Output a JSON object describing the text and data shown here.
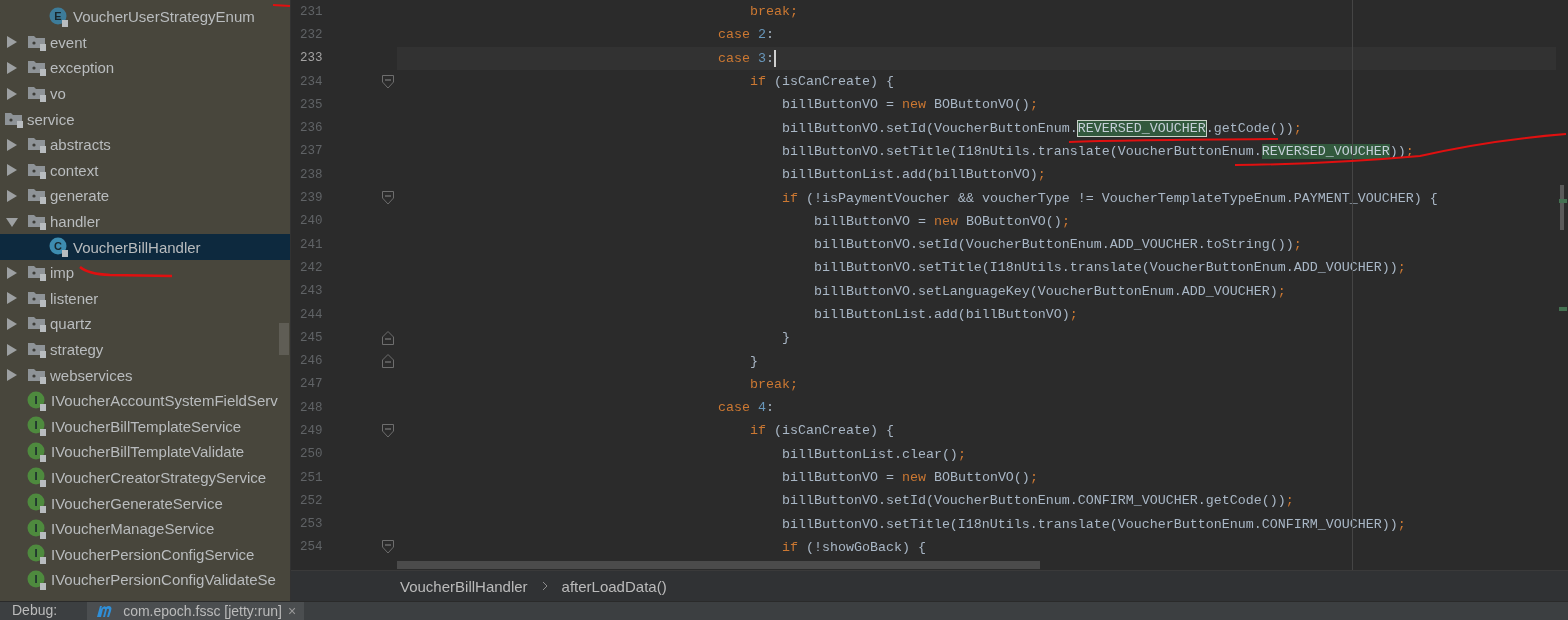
{
  "project_tree": [
    {
      "children": [
        {
          "children": [
            {
              "kind": "enum",
              "icon_letter": "E",
              "label": "VoucherUserStrategyEnum",
              "selected": false
            }
          ]
        },
        {
          "kind": "folder",
          "label": "event",
          "expanded": false,
          "selected": false
        },
        {
          "kind": "folder",
          "label": "exception",
          "expanded": false,
          "selected": false
        },
        {
          "kind": "folder",
          "label": "vo",
          "expanded": false,
          "selected": false
        }
      ]
    },
    {
      "kind": "package",
      "label": "service",
      "selected": false,
      "children": [
        {
          "kind": "folder",
          "label": "abstracts",
          "expanded": false,
          "selected": false
        },
        {
          "kind": "folder",
          "label": "context",
          "expanded": false,
          "selected": false
        },
        {
          "kind": "folder",
          "label": "generate",
          "expanded": false,
          "selected": false
        },
        {
          "kind": "folder",
          "label": "handler",
          "expanded": true,
          "selected": false,
          "children": [
            {
              "kind": "class",
              "icon_letter": "C",
              "label": "VoucherBillHandler",
              "selected": true
            }
          ]
        },
        {
          "kind": "folder",
          "label": "imp",
          "expanded": false,
          "selected": false
        },
        {
          "kind": "folder",
          "label": "listener",
          "expanded": false,
          "selected": false
        },
        {
          "kind": "folder",
          "label": "quartz",
          "expanded": false,
          "selected": false
        },
        {
          "kind": "folder",
          "label": "strategy",
          "expanded": false,
          "selected": false
        },
        {
          "kind": "folder",
          "label": "webservices",
          "expanded": false,
          "selected": false
        },
        {
          "kind": "interface",
          "icon_letter": "I",
          "label": "IVoucherAccountSystemFieldServ",
          "selected": false
        },
        {
          "kind": "interface",
          "icon_letter": "I",
          "label": "IVoucherBillTemplateService",
          "selected": false
        },
        {
          "kind": "interface",
          "icon_letter": "I",
          "label": "IVoucherBillTemplateValidate",
          "selected": false
        },
        {
          "kind": "interface",
          "icon_letter": "I",
          "label": "IVoucherCreatorStrategyService",
          "selected": false
        },
        {
          "kind": "interface",
          "icon_letter": "I",
          "label": "IVoucherGenerateService",
          "selected": false
        },
        {
          "kind": "interface",
          "icon_letter": "I",
          "label": "IVoucherManageService",
          "selected": false
        },
        {
          "kind": "interface",
          "icon_letter": "I",
          "label": "IVoucherPersionConfigService",
          "selected": false
        },
        {
          "kind": "interface",
          "icon_letter": "I",
          "label": "IVoucherPersionConfigValidateSe",
          "selected": false
        }
      ]
    }
  ],
  "editor": {
    "lines": [
      {
        "number": "231",
        "kind": "plain",
        "current": false,
        "tokens": [
          {
            "kind": "keyword",
            "text": "                                            break;"
          }
        ]
      },
      {
        "number": "232",
        "kind": "plain",
        "current": false,
        "tokens": [
          {
            "kind": "keyword",
            "text": "                                        case "
          },
          {
            "kind": "number",
            "text": "2"
          },
          {
            "kind": "plain",
            "text": ":"
          }
        ]
      },
      {
        "number": "233",
        "kind": "plain",
        "current": true,
        "tokens": [
          {
            "kind": "keyword",
            "text": "                                        case "
          },
          {
            "kind": "number",
            "text": "3"
          },
          {
            "kind": "plain",
            "text": ":"
          }
        ]
      },
      {
        "number": "234",
        "kind": "fold_start",
        "current": false,
        "tokens": [
          {
            "kind": "keyword",
            "text": "                                            if "
          },
          {
            "kind": "plain",
            "text": "(isCanCreate) {"
          }
        ]
      },
      {
        "number": "235",
        "kind": "plain",
        "current": false,
        "tokens": [
          {
            "kind": "plain",
            "text": "                                                billButtonVO = "
          },
          {
            "kind": "keyword",
            "text": "new "
          },
          {
            "kind": "plain",
            "text": "BOButtonVO()"
          },
          {
            "kind": "keyword",
            "text": ";"
          }
        ]
      },
      {
        "number": "236",
        "kind": "plain",
        "current": false,
        "tokens": [
          {
            "kind": "plain",
            "text": "                                                billButtonVO.setId(VoucherButtonEnum."
          },
          {
            "kind": "match_selected",
            "text": "REVERSED_VOUCHER"
          },
          {
            "kind": "plain",
            "text": ".getCode())"
          },
          {
            "kind": "keyword",
            "text": ";"
          }
        ]
      },
      {
        "number": "237",
        "kind": "plain",
        "current": false,
        "tokens": [
          {
            "kind": "plain",
            "text": "                                                billButtonVO.setTitle(I18nUtils.translate(VoucherButtonEnum."
          },
          {
            "kind": "match",
            "text": "REVERSED_VOUCHER"
          },
          {
            "kind": "plain",
            "text": "))"
          },
          {
            "kind": "keyword",
            "text": ";"
          }
        ]
      },
      {
        "number": "238",
        "kind": "plain",
        "current": false,
        "tokens": [
          {
            "kind": "plain",
            "text": "                                                billButtonList.add(billButtonVO)"
          },
          {
            "kind": "keyword",
            "text": ";"
          }
        ]
      },
      {
        "number": "239",
        "kind": "fold_start",
        "current": false,
        "tokens": [
          {
            "kind": "keyword",
            "text": "                                                if "
          },
          {
            "kind": "plain",
            "text": "(!isPaymentVoucher && voucherType != VoucherTemplateTypeEnum.PAYMENT_VOUCHER) {"
          }
        ]
      },
      {
        "number": "240",
        "kind": "plain",
        "current": false,
        "tokens": [
          {
            "kind": "plain",
            "text": "                                                    billButtonVO = "
          },
          {
            "kind": "keyword",
            "text": "new "
          },
          {
            "kind": "plain",
            "text": "BOButtonVO()"
          },
          {
            "kind": "keyword",
            "text": ";"
          }
        ]
      },
      {
        "number": "241",
        "kind": "plain",
        "current": false,
        "tokens": [
          {
            "kind": "plain",
            "text": "                                                    billButtonVO.setId(VoucherButtonEnum.ADD_VOUCHER.toString())"
          },
          {
            "kind": "keyword",
            "text": ";"
          }
        ]
      },
      {
        "number": "242",
        "kind": "plain",
        "current": false,
        "tokens": [
          {
            "kind": "plain",
            "text": "                                                    billButtonVO.setTitle(I18nUtils.translate(VoucherButtonEnum.ADD_VOUCHER))"
          },
          {
            "kind": "keyword",
            "text": ";"
          }
        ]
      },
      {
        "number": "243",
        "kind": "plain",
        "current": false,
        "tokens": [
          {
            "kind": "plain",
            "text": "                                                    billButtonVO.setLanguageKey(VoucherButtonEnum.ADD_VOUCHER)"
          },
          {
            "kind": "keyword",
            "text": ";"
          }
        ]
      },
      {
        "number": "244",
        "kind": "plain",
        "current": false,
        "tokens": [
          {
            "kind": "plain",
            "text": "                                                    billButtonList.add(billButtonVO)"
          },
          {
            "kind": "keyword",
            "text": ";"
          }
        ]
      },
      {
        "number": "245",
        "kind": "fold_end",
        "current": false,
        "tokens": [
          {
            "kind": "plain",
            "text": "                                                }"
          }
        ]
      },
      {
        "number": "246",
        "kind": "fold_end",
        "current": false,
        "tokens": [
          {
            "kind": "plain",
            "text": "                                            }"
          }
        ]
      },
      {
        "number": "247",
        "kind": "plain",
        "current": false,
        "tokens": [
          {
            "kind": "keyword",
            "text": "                                            break;"
          }
        ]
      },
      {
        "number": "248",
        "kind": "plain",
        "current": false,
        "tokens": [
          {
            "kind": "keyword",
            "text": "                                        case "
          },
          {
            "kind": "number",
            "text": "4"
          },
          {
            "kind": "plain",
            "text": ":"
          }
        ]
      },
      {
        "number": "249",
        "kind": "fold_start",
        "current": false,
        "tokens": [
          {
            "kind": "keyword",
            "text": "                                            if "
          },
          {
            "kind": "plain",
            "text": "(isCanCreate) {"
          }
        ]
      },
      {
        "number": "250",
        "kind": "plain",
        "current": false,
        "tokens": [
          {
            "kind": "plain",
            "text": "                                                billButtonList.clear()"
          },
          {
            "kind": "keyword",
            "text": ";"
          }
        ]
      },
      {
        "number": "251",
        "kind": "plain",
        "current": false,
        "tokens": [
          {
            "kind": "plain",
            "text": "                                                billButtonVO = "
          },
          {
            "kind": "keyword",
            "text": "new "
          },
          {
            "kind": "plain",
            "text": "BOButtonVO()"
          },
          {
            "kind": "keyword",
            "text": ";"
          }
        ]
      },
      {
        "number": "252",
        "kind": "plain",
        "current": false,
        "tokens": [
          {
            "kind": "plain",
            "text": "                                                billButtonVO.setId(VoucherButtonEnum.CONFIRM_VOUCHER.getCode())"
          },
          {
            "kind": "keyword",
            "text": ";"
          }
        ]
      },
      {
        "number": "253",
        "kind": "plain",
        "current": false,
        "tokens": [
          {
            "kind": "plain",
            "text": "                                                billButtonVO.setTitle(I18nUtils.translate(VoucherButtonEnum.CONFIRM_VOUCHER))"
          },
          {
            "kind": "keyword",
            "text": ";"
          }
        ]
      },
      {
        "number": "254",
        "kind": "fold_start",
        "current": false,
        "tokens": [
          {
            "kind": "keyword",
            "text": "                                                if "
          },
          {
            "kind": "plain",
            "text": "(!showGoBack) {"
          }
        ]
      }
    ]
  },
  "breadcrumbs": [
    "VoucherBillHandler",
    "afterLoadData()"
  ],
  "debug_bar": {
    "label": "Debug:",
    "tab": "com.epoch.fssc [jetty:run]",
    "tab_close": "×"
  }
}
